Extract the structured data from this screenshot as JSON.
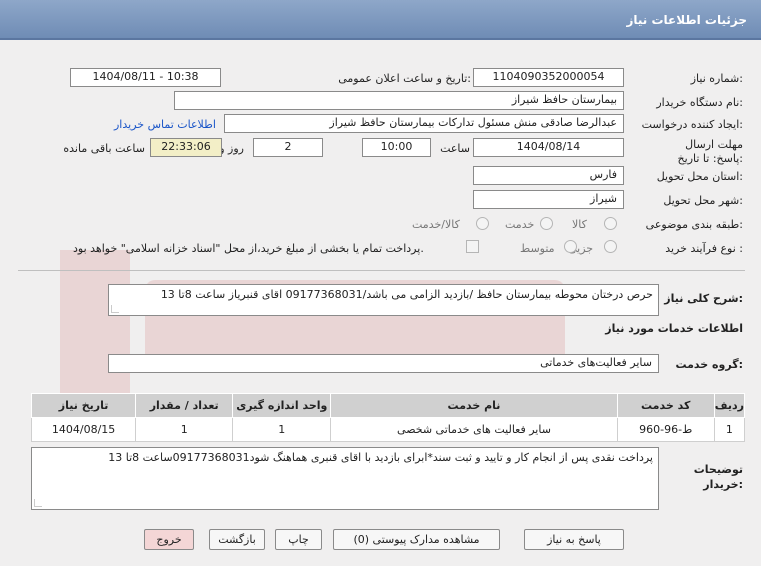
{
  "header": {
    "title": "جزئیات اطلاعات نیاز"
  },
  "form": {
    "need_number_label": "شماره نیاز:",
    "need_number": "1104090352000054",
    "announce_label": "تاریخ و ساعت اعلان عمومی:",
    "announce_value": "1404/08/11 - 10:38",
    "buyer_org_label": "نام دستگاه خریدار:",
    "buyer_org": "بیمارستان حافظ شیراز",
    "requester_label": "ایجاد کننده درخواست:",
    "requester": "عبدالرضا صادقی منش مسئول تدارکات بیمارستان حافظ شیراز",
    "contact_link": "اطلاعات تماس خریدار",
    "deadline_label": "مهلت ارسال پاسخ: تا تاریخ:",
    "deadline_date": "1404/08/14",
    "time_label": "ساعت",
    "deadline_time": "10:00",
    "days_value": "2",
    "days_label": "روز و",
    "remaining_value": "22:33:06",
    "remaining_label": "ساعت باقی مانده",
    "province_label": "استان محل تحویل:",
    "province": "فارس",
    "city_label": "شهر محل تحویل:",
    "city": "شیراز",
    "category_label": "طبقه بندی موضوعی:",
    "category_options": [
      "کالا",
      "خدمت",
      "کالا/خدمت"
    ],
    "purchase_type_label": "نوع فرآیند خرید :",
    "purchase_options": [
      "جزیی",
      "متوسط"
    ],
    "payment_note": "پرداخت تمام یا بخشی از مبلغ خرید،از محل \"اسناد خزانه اسلامی\" خواهد بود."
  },
  "description": {
    "label": "شرح کلی نیاز:",
    "text": "حرص درختان محوطه بیمارستان حافظ /بازدید الزامی می باشد/09177368031 اقای قنبریاز ساعت 8تا 13"
  },
  "services": {
    "section_title": "اطلاعات خدمات مورد نیاز",
    "group_label": "گروه خدمت:",
    "group_value": "سایر فعالیت‌های خدماتی",
    "columns": [
      "ردیف",
      "کد خدمت",
      "نام خدمت",
      "واحد اندازه گیری",
      "تعداد / مقدار",
      "تاریخ نیاز"
    ],
    "rows": [
      [
        "1",
        "ط-96-960",
        "سایر فعالیت های خدماتی شخصی",
        "1",
        "1",
        "1404/08/15"
      ]
    ]
  },
  "buyer_notes": {
    "label": "توضیحات خریدار:",
    "text": "پرداخت نقدی پس از انجام کار و تایید و ثبت سند*ابرای بازدید با اقای قنبری هماهنگ شود09177368031ساعت 8تا 13"
  },
  "buttons": {
    "reply": "پاسخ به نیاز",
    "attachments": "مشاهده مدارک پیوستی (0)",
    "print": "چاپ",
    "back": "بازگشت",
    "exit": "خروج"
  },
  "colors": {
    "header": "#7b96bd",
    "link": "#1a55c8",
    "remaining_bg": "#f3efc7",
    "exit_bg": "#f4d6d6"
  }
}
